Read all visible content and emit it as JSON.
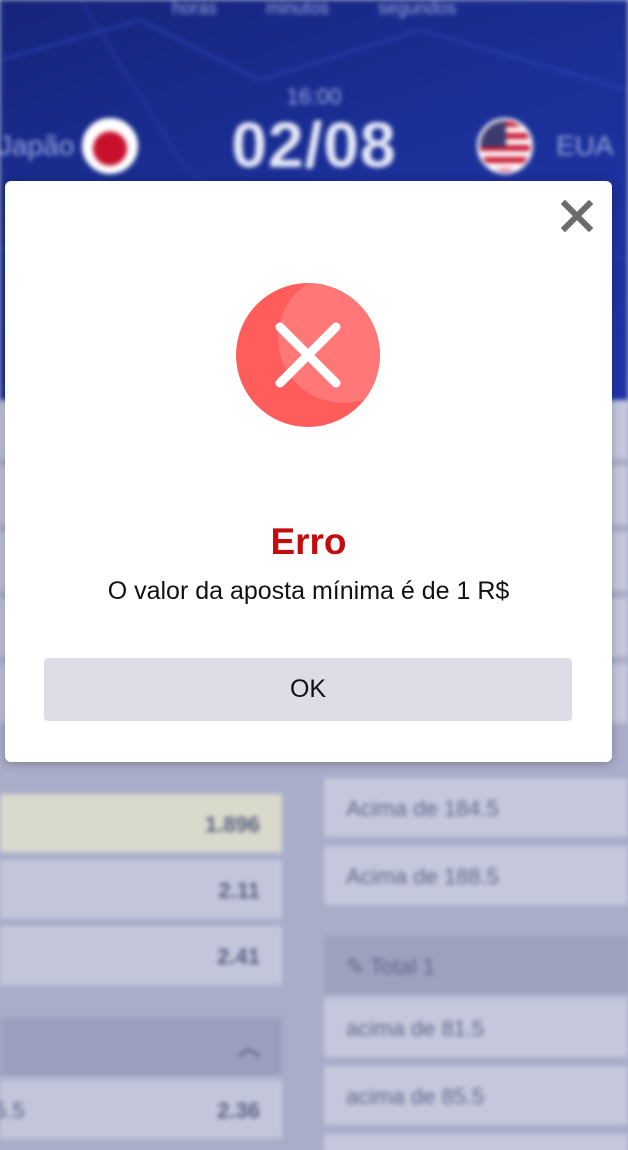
{
  "background": {
    "timer_labels": [
      "horas",
      "minutos",
      "segundos"
    ],
    "match_time": "16:00",
    "match_date": "02/08",
    "team_left": "Japão",
    "team_right": "EUA",
    "left_rows": [
      "1.896",
      "2.11",
      "2.41",
      "2.36"
    ],
    "left_partial_label": "5.5",
    "right_rows": [
      "Acima de 184.5",
      "Acima de 188.5",
      "acima de 81.5",
      "acima de 85.5"
    ],
    "right_section_title": "Total 1"
  },
  "modal": {
    "title": "Erro",
    "message": "O valor da aposta mínima é de 1 R$",
    "ok_label": "OK",
    "close_icon": "close-icon",
    "status_icon": "error-x-icon"
  },
  "colors": {
    "error_title": "#c40c0c",
    "error_circle": "#ff5c5c",
    "ok_button_bg": "#dcdde6",
    "hero_bg": "#1a2f97"
  }
}
